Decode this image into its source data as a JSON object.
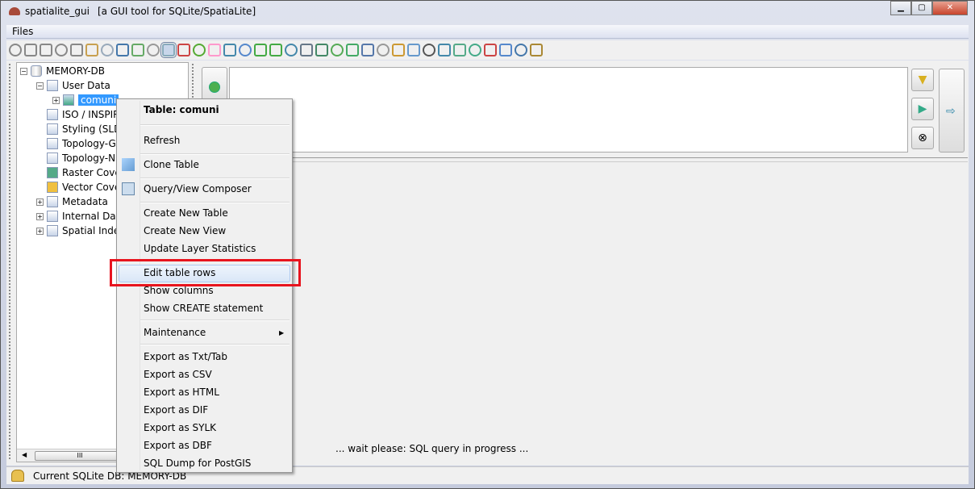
{
  "window": {
    "app_name": "spatialite_gui",
    "subtitle": "[a GUI tool for SQLite/SpatiaLite]",
    "minimize": "▁",
    "maximize": "▢",
    "close": "✕"
  },
  "menubar": {
    "files": "Files"
  },
  "toolbar": {
    "icons": [
      "connect-icon",
      "disconnect-icon",
      "create-db-icon",
      "memory-db-icon",
      "close-memory-db-icon",
      "clock-add-icon",
      "save-db-icon",
      "plug-icon",
      "refresh-db-icon",
      "vacuum-icon",
      "sql-script-icon",
      "chart-icon",
      "bug-icon",
      "hand-icon",
      "load-shp-icon",
      "edit-icon",
      "globe-icon",
      "globe2-icon",
      "export-icon",
      "dbf-icon",
      "txt-icon",
      "xls-icon",
      "load-icon",
      "network-icon",
      "eye-icon",
      "layers-icon",
      "copy-icon",
      "list-icon",
      "wand-icon",
      "map-icon",
      "check-icon",
      "pdf-icon",
      "help-icon",
      "about-icon",
      "exit-icon"
    ],
    "active_index": 10
  },
  "tree": {
    "root": "MEMORY-DB",
    "items": [
      {
        "label": "User Data",
        "expanded": true
      },
      {
        "label": "comuni",
        "selected": true
      },
      {
        "label": "ISO / INSPIRE"
      },
      {
        "label": "Styling (SLD"
      },
      {
        "label": "Topology-G"
      },
      {
        "label": "Topology-N"
      },
      {
        "label": "Raster Cove"
      },
      {
        "label": "Vector Cove"
      },
      {
        "label": "Metadata"
      },
      {
        "label": "Internal Dat"
      },
      {
        "label": "Spatial Index"
      }
    ],
    "scroll_thumb": "III"
  },
  "query": {
    "wait": "... wait please: SQL query in progress ..."
  },
  "context_menu": {
    "header": "Table: comuni",
    "items": {
      "refresh": "Refresh",
      "clone": "Clone Table",
      "composer": "Query/View Composer",
      "new_table": "Create New Table",
      "new_view": "Create New View",
      "update_stats": "Update Layer Statistics",
      "edit_rows": "Edit table rows",
      "show_columns": "Show columns",
      "show_create": "Show CREATE statement",
      "maintenance": "Maintenance",
      "export_txt": "Export as Txt/Tab",
      "export_csv": "Export as CSV",
      "export_html": "Export as HTML",
      "export_dif": "Export as DIF",
      "export_sylk": "Export as SYLK",
      "export_dbf": "Export as DBF",
      "sql_dump": "SQL Dump for PostGIS"
    },
    "highlighted": "Edit table rows",
    "highlight_color": "#e8141e"
  },
  "status": {
    "text": "Current SQLite DB: MEMORY-DB"
  }
}
